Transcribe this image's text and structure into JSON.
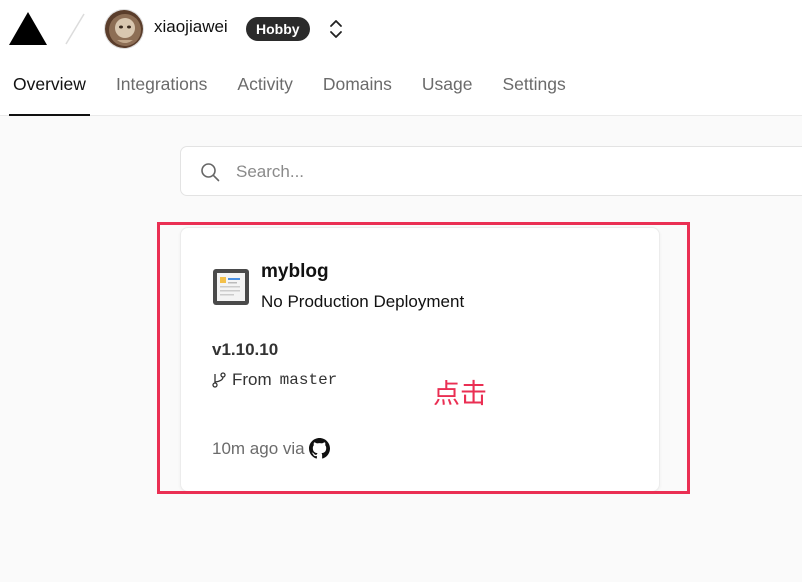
{
  "header": {
    "logo_icon": "vercel-triangle-icon",
    "username": "xiaojiawei",
    "plan_badge": "Hobby",
    "switcher_icon": "chevron-up-down-icon"
  },
  "tabs": [
    {
      "label": "Overview",
      "active": true
    },
    {
      "label": "Integrations",
      "active": false
    },
    {
      "label": "Activity",
      "active": false
    },
    {
      "label": "Domains",
      "active": false
    },
    {
      "label": "Usage",
      "active": false
    },
    {
      "label": "Settings",
      "active": false
    }
  ],
  "search": {
    "placeholder": "Search...",
    "value": ""
  },
  "project_card": {
    "name": "myblog",
    "status": "No Production Deployment",
    "version": "v1.10.10",
    "branch_prefix": "From",
    "branch": "master",
    "time": "10m ago via",
    "source_icon": "github-icon"
  },
  "annotation": {
    "text": "点击",
    "color": "#ea2f53"
  },
  "colors": {
    "accent_red": "#ea2f53",
    "badge_bg": "#2b2b2b",
    "background": "#fafafa"
  }
}
